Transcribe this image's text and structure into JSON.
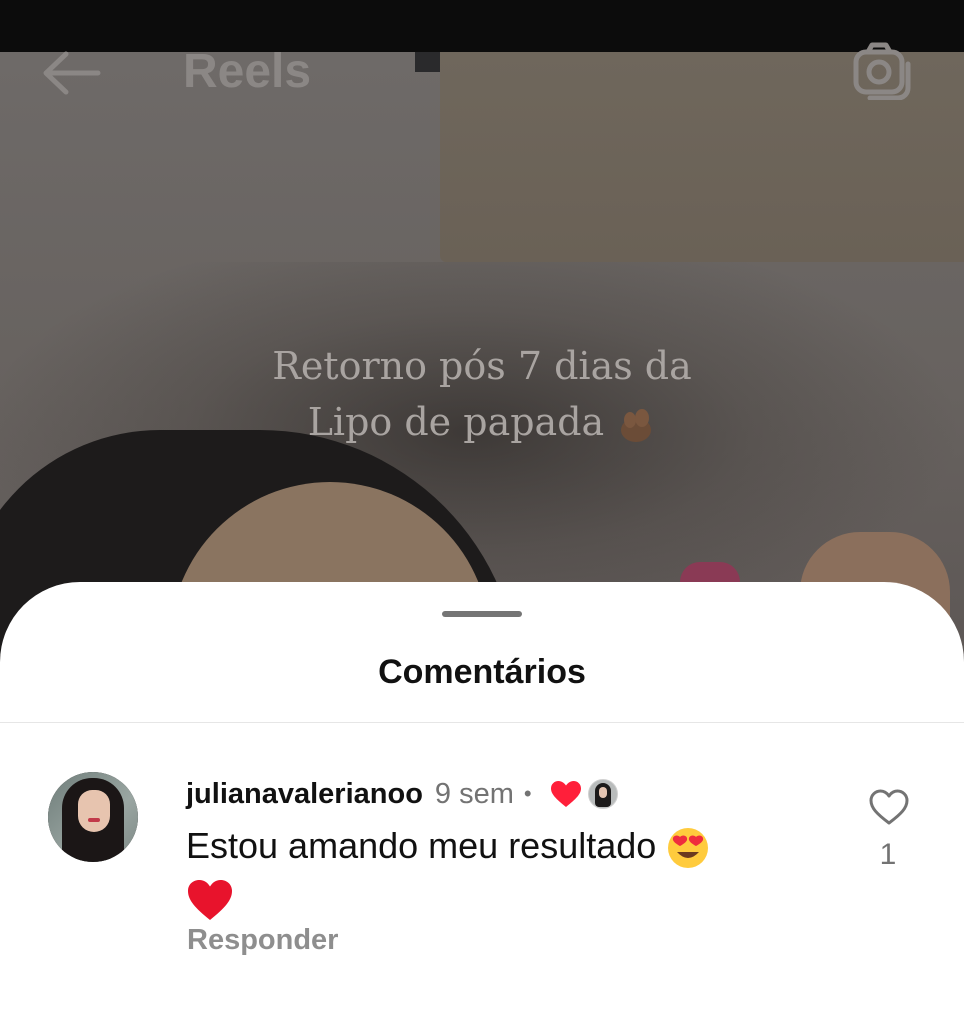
{
  "topbar": {
    "title": "Reels",
    "back_icon": "arrow-left-icon",
    "camera_icon": "camera-icon"
  },
  "video": {
    "caption_line1": "Retorno pós 7 dias da",
    "caption_line2": "Lipo de papada"
  },
  "comments_sheet": {
    "title": "Comentários",
    "comments": [
      {
        "username": "julianavalerianoo",
        "time": "9 sem",
        "separator": "•",
        "text": "Estou amando meu resultado",
        "reply_label": "Responder",
        "like_count": "1"
      }
    ]
  },
  "colors": {
    "sheet_background": "#ffffff",
    "heart_red": "#ff3040",
    "muted_text": "#737373"
  }
}
